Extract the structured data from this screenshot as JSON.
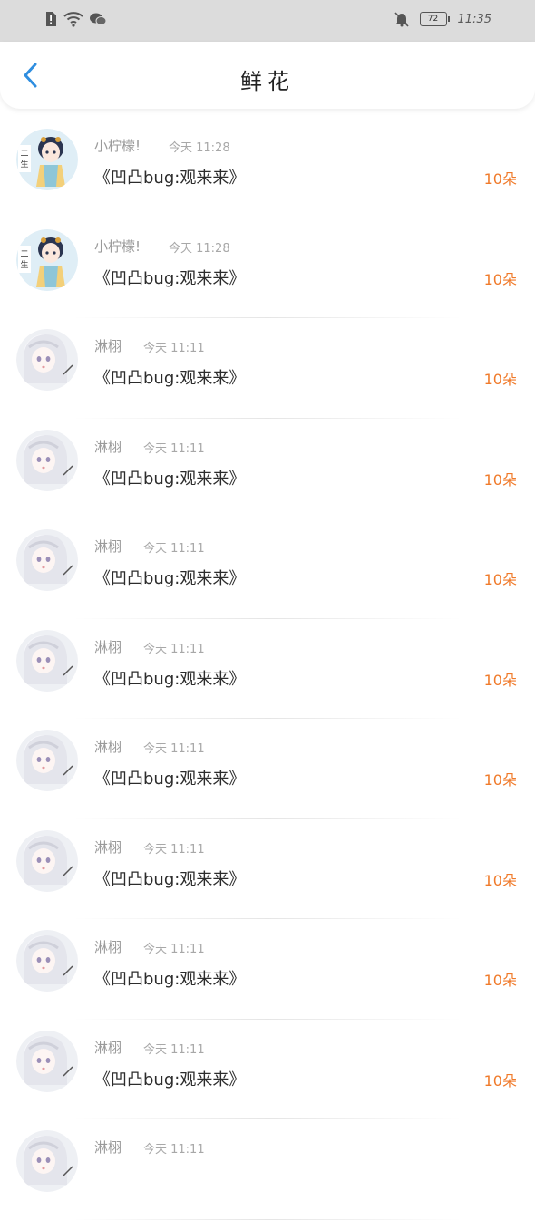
{
  "status_bar": {
    "battery": "72",
    "time": "11:35"
  },
  "header": {
    "title": "鲜花"
  },
  "items": [
    {
      "name": "小柠檬!",
      "time": "今天 11:28",
      "desc": "《凹凸bug:观来来》",
      "count": "10朵",
      "avatar": "anime-girl-blue"
    },
    {
      "name": "小柠檬!",
      "time": "今天 11:28",
      "desc": "《凹凸bug:观来来》",
      "count": "10朵",
      "avatar": "anime-girl-blue"
    },
    {
      "name": "淋栩",
      "time": "今天 11:11",
      "desc": "《凹凸bug:观来来》",
      "count": "10朵",
      "avatar": "anime-girl-white"
    },
    {
      "name": "淋栩",
      "time": "今天 11:11",
      "desc": "《凹凸bug:观来来》",
      "count": "10朵",
      "avatar": "anime-girl-white"
    },
    {
      "name": "淋栩",
      "time": "今天 11:11",
      "desc": "《凹凸bug:观来来》",
      "count": "10朵",
      "avatar": "anime-girl-white"
    },
    {
      "name": "淋栩",
      "time": "今天 11:11",
      "desc": "《凹凸bug:观来来》",
      "count": "10朵",
      "avatar": "anime-girl-white"
    },
    {
      "name": "淋栩",
      "time": "今天 11:11",
      "desc": "《凹凸bug:观来来》",
      "count": "10朵",
      "avatar": "anime-girl-white"
    },
    {
      "name": "淋栩",
      "time": "今天 11:11",
      "desc": "《凹凸bug:观来来》",
      "count": "10朵",
      "avatar": "anime-girl-white"
    },
    {
      "name": "淋栩",
      "time": "今天 11:11",
      "desc": "《凹凸bug:观来来》",
      "count": "10朵",
      "avatar": "anime-girl-white"
    },
    {
      "name": "淋栩",
      "time": "今天 11:11",
      "desc": "《凹凸bug:观来来》",
      "count": "10朵",
      "avatar": "anime-girl-white"
    },
    {
      "name": "淋栩",
      "time": "今天 11:11",
      "desc": "",
      "count": "",
      "avatar": "anime-girl-white"
    }
  ],
  "colors": {
    "accent": "#2f8ee0",
    "count": "#f07a2a"
  }
}
